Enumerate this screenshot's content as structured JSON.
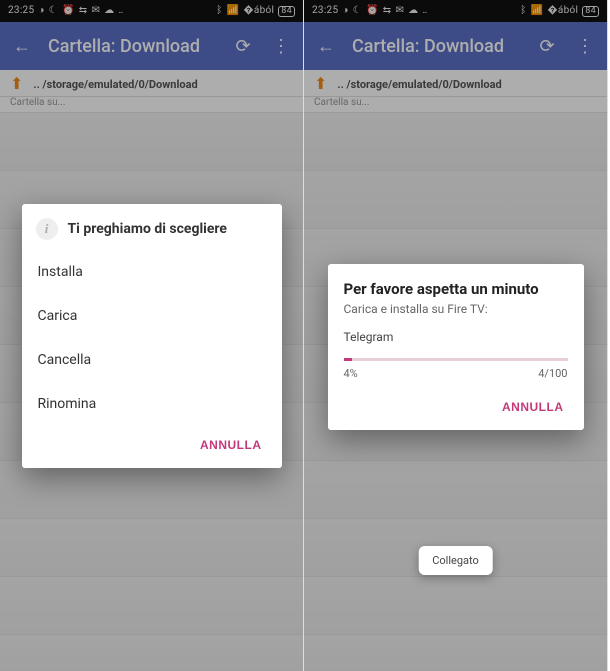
{
  "status": {
    "time": "23:25",
    "battery": "84"
  },
  "appbar": {
    "title": "Cartella: Download"
  },
  "crumb": {
    "path": ".. /storage/emulated/0/Download",
    "folder_label": "Cartella su..."
  },
  "dialog1": {
    "title": "Ti preghiamo di scegliere",
    "options": {
      "install": "Installa",
      "load": "Carica",
      "delete": "Cancella",
      "rename": "Rinomina"
    },
    "cancel": "ANNULLA"
  },
  "dialog2": {
    "title": "Per favore aspetta un minuto",
    "subtitle": "Carica e installa su Fire TV:",
    "item": "Telegram",
    "progress_percent": 4,
    "progress_text_left": "4%",
    "progress_text_right": "4/100",
    "cancel": "ANNULLA"
  },
  "toast": {
    "text": "Collegato"
  }
}
